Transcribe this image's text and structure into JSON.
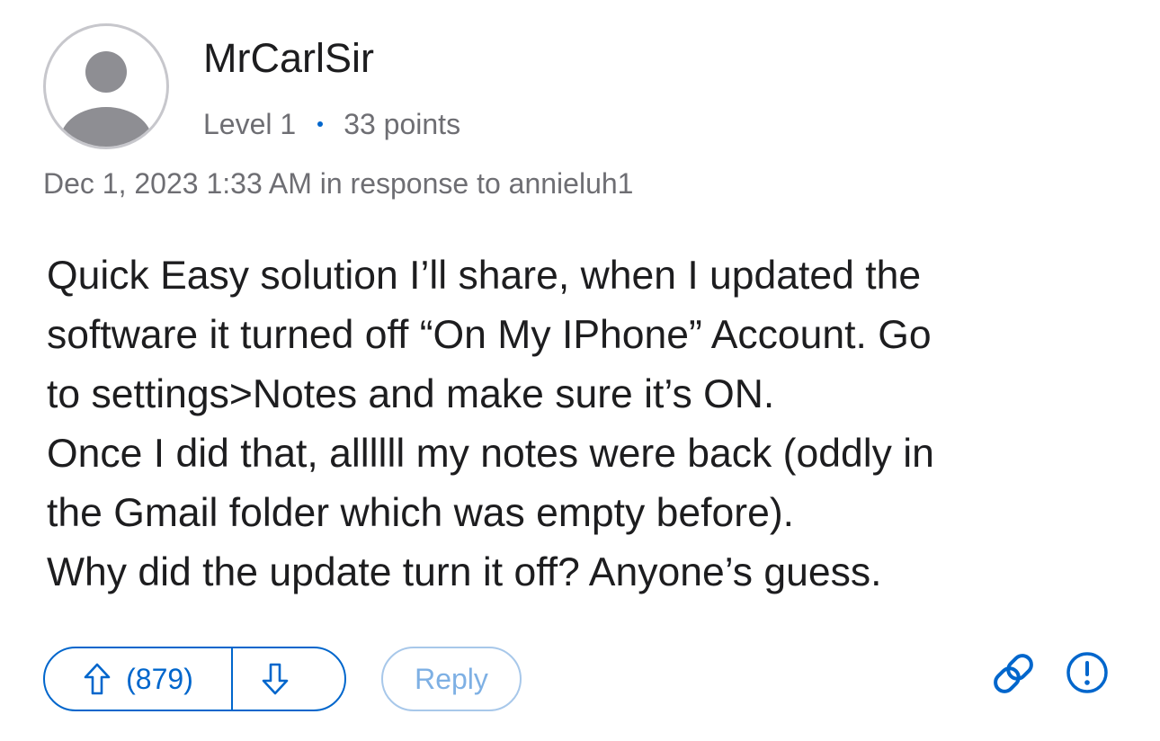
{
  "author": {
    "name": "MrCarlSir",
    "level": "Level 1",
    "points": "33 points"
  },
  "post": {
    "timestamp": "Dec 1, 2023 1:33 AM in response to annieluh1",
    "body_lines": [
      "Quick Easy solution I’ll share, when I updated the",
      "software it turned off “On My IPhone” Account. Go",
      "to settings>Notes and make sure it’s ON.",
      "Once I did that, allllll my notes were back (oddly in",
      "the Gmail folder which was empty before).",
      "Why did the update turn it off? Anyone’s guess."
    ]
  },
  "actions": {
    "vote_count": "(879)",
    "reply_label": "Reply",
    "upvote_icon": "arrow-up-icon",
    "downvote_icon": "arrow-down-icon",
    "link_icon": "link-icon",
    "report_icon": "exclamation-circle-icon"
  },
  "colors": {
    "accent": "#0066cc",
    "reply_muted": "#7eb0e4",
    "secondary_text": "#6e6e73",
    "avatar_gray": "#8e8e93"
  }
}
